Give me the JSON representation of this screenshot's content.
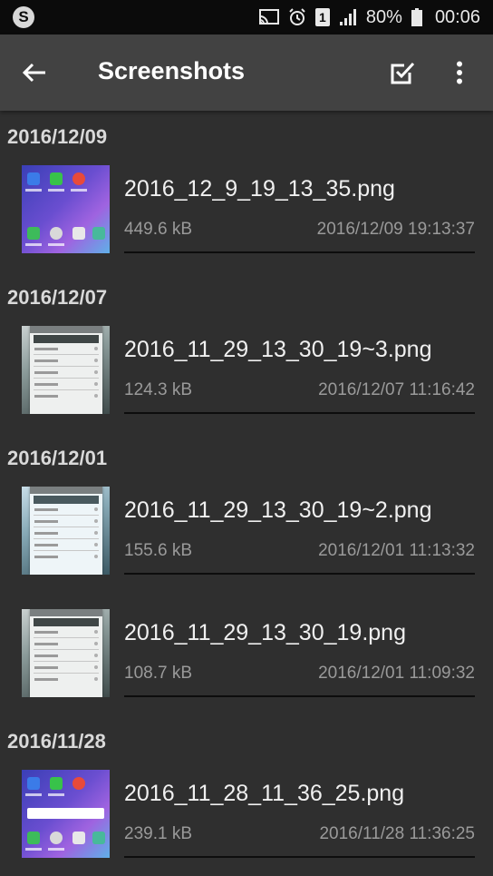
{
  "status_bar": {
    "left_icon": "skype-icon",
    "icons": [
      "cast-icon",
      "alarm-icon",
      "sim-1-icon",
      "signal-icon"
    ],
    "sim_label": "1",
    "battery_percent": "80%",
    "time": "00:06"
  },
  "app_bar": {
    "title": "Screenshots",
    "back_icon": "back-arrow-icon",
    "select_icon": "select-all-checkbox-icon",
    "more_icon": "more-vert-icon"
  },
  "groups": [
    {
      "date": "2016/12/09",
      "items": [
        {
          "filename": "2016_12_9_19_13_35.png",
          "size": "449.6 kB",
          "modified": "2016/12/09 19:13:37",
          "thumb": "home-screen"
        }
      ]
    },
    {
      "date": "2016/12/07",
      "items": [
        {
          "filename": "2016_11_29_13_30_19~3.png",
          "size": "124.3 kB",
          "modified": "2016/12/07 11:16:42",
          "thumb": "dialog"
        }
      ]
    },
    {
      "date": "2016/12/01",
      "items": [
        {
          "filename": "2016_11_29_13_30_19~2.png",
          "size": "155.6 kB",
          "modified": "2016/12/01 11:13:32",
          "thumb": "dialog-blue"
        },
        {
          "filename": "2016_11_29_13_30_19.png",
          "size": "108.7 kB",
          "modified": "2016/12/01 11:09:32",
          "thumb": "dialog"
        }
      ]
    },
    {
      "date": "2016/11/28",
      "items": [
        {
          "filename": "2016_11_28_11_36_25.png",
          "size": "239.1 kB",
          "modified": "2016/11/28 11:36:25",
          "thumb": "home-screen-search"
        }
      ]
    }
  ],
  "colors": {
    "background": "#2f2f2f",
    "app_bar": "#424242",
    "status_bar": "#0b0b0b",
    "divider": "#0d0d0d",
    "secondary_text": "#9a9a9a"
  }
}
